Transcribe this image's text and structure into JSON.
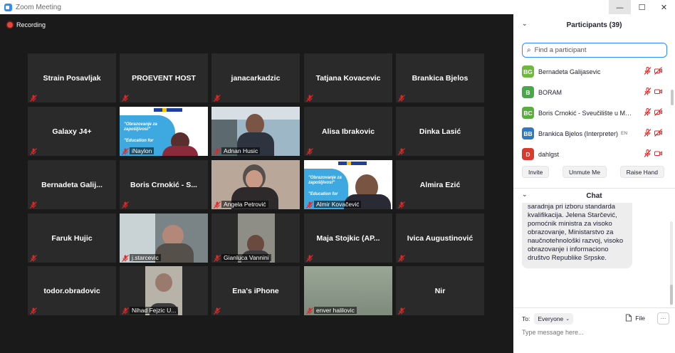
{
  "window": {
    "title": "Zoom Meeting"
  },
  "recording": {
    "label": "Recording"
  },
  "tiles": [
    {
      "name": "Strain Posavljak",
      "type": "name"
    },
    {
      "name": "PROEVENT HOST",
      "type": "name"
    },
    {
      "name": "janacarkadzic",
      "type": "name"
    },
    {
      "name": "Tatjana Kovacevic",
      "type": "name"
    },
    {
      "name": "Brankica Bjelos",
      "type": "name"
    },
    {
      "name": "Galaxy J4+",
      "type": "name"
    },
    {
      "name": "iNaylon",
      "type": "video"
    },
    {
      "name": "Adnan Husic",
      "type": "video"
    },
    {
      "name": "Alisa Ibrakovic",
      "type": "name"
    },
    {
      "name": "Dinka Lasić",
      "type": "name"
    },
    {
      "name": "Bernadeta  Galij...",
      "type": "name"
    },
    {
      "name": "Boris  Crnokić  -  S...",
      "type": "name"
    },
    {
      "name": "Angela Petrović",
      "type": "video"
    },
    {
      "name": "Almir Kovačević",
      "type": "video"
    },
    {
      "name": "Almira Ezić",
      "type": "name"
    },
    {
      "name": "Faruk Hujic",
      "type": "name"
    },
    {
      "name": "j.starcevic",
      "type": "video"
    },
    {
      "name": "Gianluca Vannini",
      "type": "video"
    },
    {
      "name": "Maja  Stojkic  (AP...",
      "type": "name"
    },
    {
      "name": "Ivica Augustinović",
      "type": "name"
    },
    {
      "name": "todor.obradovic",
      "type": "name"
    },
    {
      "name": "Nihad Fejzic U...",
      "type": "video"
    },
    {
      "name": "Ena's iPhone",
      "type": "name"
    },
    {
      "name": "enver halilovic",
      "type": "video"
    },
    {
      "name": "Nir",
      "type": "name"
    }
  ],
  "slide": {
    "headline": "\"Obrazovanje za zapošljivost\"",
    "sub": "\"Education for"
  },
  "participants": {
    "header": "Participants (39)",
    "search_placeholder": "Find a participant",
    "list": [
      {
        "initials": "BG",
        "color": "#6fb83e",
        "name": "Bernadeta Galijasevic",
        "tag": ""
      },
      {
        "initials": "B",
        "color": "#4aa64a",
        "name": "BORAM",
        "tag": ""
      },
      {
        "initials": "BC",
        "color": "#5aae3e",
        "name": "Boris Crnokić - Sveučilište u Mo...",
        "tag": ""
      },
      {
        "initials": "BB",
        "color": "#2f78c4",
        "name": "Brankica Bjelos (Interpreter)",
        "tag": "EN"
      },
      {
        "initials": "D",
        "color": "#d93a2e",
        "name": "dahlgst",
        "tag": ""
      }
    ],
    "buttons": {
      "invite": "Invite",
      "unmute": "Unmute Me",
      "raise": "Raise Hand"
    }
  },
  "chat": {
    "header": "Chat",
    "message": "saradnja pri izboru standarda kvalifikacija. Jelena Starčević, pomoćnik ministra za visoko obrazovanje, Ministarstvo za naučnotehnološki razvoj, visoko obrazovanje i informaciono društvo Republike Srpske.",
    "to_label": "To:",
    "to_value": "Everyone",
    "file_label": "File",
    "more_label": "···",
    "input_placeholder": "Type message here..."
  },
  "colors": {
    "accent": "#2d8cff",
    "muted_mic": "#e02828",
    "active_speaker": "#b5d84a"
  },
  "icons": [
    "zoom-logo-icon",
    "recording-dot-icon",
    "muted-mic-icon",
    "video-off-icon",
    "video-icon",
    "search-icon",
    "chevron-down-icon",
    "file-icon",
    "more-icon"
  ]
}
